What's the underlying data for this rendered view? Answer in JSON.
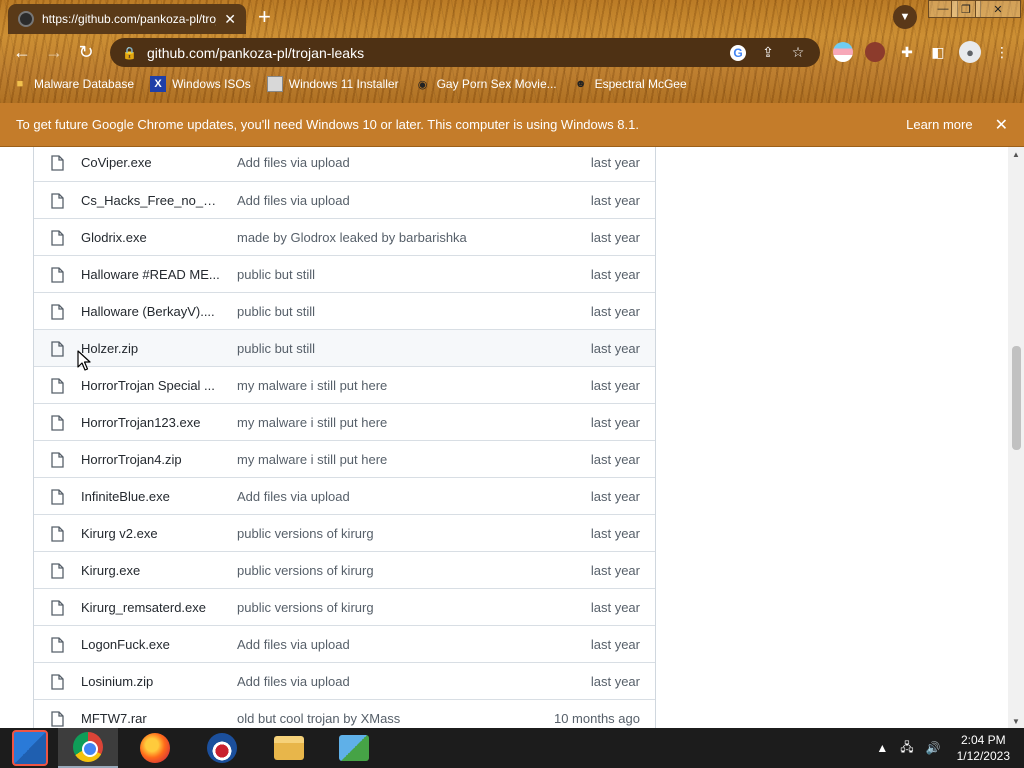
{
  "browser": {
    "tab_title": "https://github.com/pankoza-pl/trojan-leaks",
    "tab_close": "✕",
    "new_tab": "+",
    "address": "github.com/pankoza-pl/trojan-leaks",
    "window_controls": {
      "minimize": "—",
      "restore": "❐",
      "close": "✕"
    }
  },
  "bookmarks": [
    {
      "label": "Malware Database",
      "icon": "folder-icon"
    },
    {
      "label": "Windows ISOs",
      "icon": "x-icon"
    },
    {
      "label": "Windows 11 Installer",
      "icon": "image-icon"
    },
    {
      "label": "Gay Porn Sex Movie...",
      "icon": "globe-icon"
    },
    {
      "label": "Espectral McGee",
      "icon": "avatar-icon"
    }
  ],
  "infobar": {
    "message": "To get future Google Chrome updates, you'll need Windows 10 or later. This computer is using Windows 8.1.",
    "learn_more": "Learn more",
    "close": "✕"
  },
  "files": [
    {
      "name": "CoViper.exe",
      "commit": "Add files via upload",
      "age": "last year"
    },
    {
      "name": "Cs_Hacks_Free_no_ha...",
      "commit": "Add files via upload",
      "age": "last year"
    },
    {
      "name": "Glodrix.exe",
      "commit": "made by Glodrox leaked by barbarishka",
      "age": "last year"
    },
    {
      "name": "Halloware #READ ME...",
      "commit": "public but still",
      "age": "last year"
    },
    {
      "name": "Halloware (BerkayV)....",
      "commit": "public but still",
      "age": "last year"
    },
    {
      "name": "Holzer.zip",
      "commit": "public but still",
      "age": "last year"
    },
    {
      "name": "HorrorTrojan Special ...",
      "commit": "my malware i still put here",
      "age": "last year"
    },
    {
      "name": "HorrorTrojan123.exe",
      "commit": "my malware i still put here",
      "age": "last year"
    },
    {
      "name": "HorrorTrojan4.zip",
      "commit": "my malware i still put here",
      "age": "last year"
    },
    {
      "name": "InfiniteBlue.exe",
      "commit": "Add files via upload",
      "age": "last year"
    },
    {
      "name": "Kirurg v2.exe",
      "commit": "public versions of kirurg",
      "age": "last year"
    },
    {
      "name": "Kirurg.exe",
      "commit": "public versions of kirurg",
      "age": "last year"
    },
    {
      "name": "Kirurg_remsaterd.exe",
      "commit": "public versions of kirurg",
      "age": "last year"
    },
    {
      "name": "LogonFuck.exe",
      "commit": "Add files via upload",
      "age": "last year"
    },
    {
      "name": "Losinium.zip",
      "commit": "Add files via upload",
      "age": "last year"
    },
    {
      "name": "MFTW7.rar",
      "commit": "old but cool trojan by XMass",
      "age": "10 months ago"
    }
  ],
  "taskbar": {
    "apps": [
      "start-icon",
      "chrome-icon",
      "firefox-icon",
      "obama-icon",
      "file-explorer-icon",
      "network-icon"
    ],
    "tray_chevron": "▲",
    "time": "2:04 PM",
    "date": "1/12/2023"
  }
}
